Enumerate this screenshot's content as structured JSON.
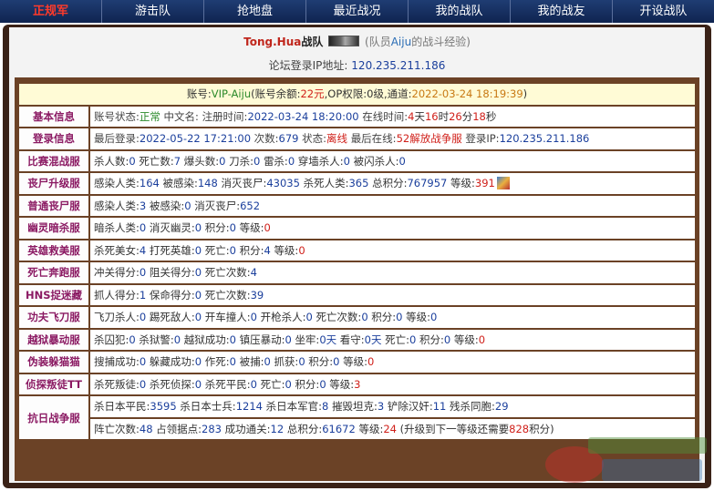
{
  "nav": {
    "items": [
      "正规军",
      "游击队",
      "抢地盘",
      "最近战况",
      "我的战队",
      "我的战友",
      "开设战队"
    ]
  },
  "header": {
    "team_name": "Tong.Hua",
    "team_suffix": "战队",
    "note_prefix": "(队员",
    "member": "Aiju",
    "note_suffix": "的战斗经验)",
    "ip_label": "论坛登录IP地址:",
    "ip_value": "120.235.211.186"
  },
  "account": {
    "label": "账号:",
    "name": "VIP-Aiju",
    "balance_label": "(账号余额:",
    "balance": "22元",
    "op_label": ",OP权限:",
    "op": "0级",
    "channel_label": ",通道:",
    "channel": "2022-03-24 18:19:39",
    "close": ")"
  },
  "rows": {
    "basic": {
      "label": "基本信息",
      "status_label": "账号状态:",
      "status": "正常",
      "cn_label": "中文名:",
      "reg_label": "注册时间:",
      "reg_time": "2022-03-24 18:20:00",
      "online_label": "在线时间:",
      "online_d": "4",
      "d": "天",
      "online_h": "16",
      "h": "时",
      "online_m": "26",
      "m": "分",
      "online_s": "18",
      "s": "秒"
    },
    "login": {
      "label": "登录信息",
      "last_label": "最后登录:",
      "last_time": "2022-05-22 17:21:00",
      "count_label": "次数:",
      "count": "679",
      "state_label": "状态:",
      "state": "离线",
      "last_online_label": "最后在线:",
      "last_online": "52解放战争服",
      "ip_label": "登录IP:",
      "ip": "120.235.211.186"
    },
    "mixed": {
      "label": "比赛混战服",
      "text_a": "杀人数:",
      "v1": "0",
      "text_b": "死亡数:",
      "v2": "7",
      "text_c": "爆头数:",
      "v3": "0",
      "text_d": "刀杀:",
      "v4": "0",
      "text_e": "雷杀:",
      "v5": "0",
      "text_f": "穿墙杀人:",
      "v6": "0",
      "text_g": "被闪杀人:",
      "v7": "0"
    },
    "zombie_up": {
      "label": "丧尸升级服",
      "t1": "感染人类:",
      "v1": "164",
      "t2": "被感染:",
      "v2": "148",
      "t3": "消灭丧尸:",
      "v3": "43035",
      "t4": "杀死人类:",
      "v4": "365",
      "t5": "总积分:",
      "v5": "767957",
      "t6": "等级:",
      "v6": "391"
    },
    "zombie": {
      "label": "普通丧尸服",
      "t1": "感染人类:",
      "v1": "3",
      "t2": "被感染:",
      "v2": "0",
      "t3": "消灭丧尸:",
      "v3": "652"
    },
    "ghost": {
      "label": "幽灵暗杀服",
      "t1": "暗杀人类:",
      "v1": "0",
      "t2": "消灭幽灵:",
      "v2": "0",
      "t3": "积分:",
      "v3": "0",
      "t4": "等级:",
      "v4": "0"
    },
    "hero": {
      "label": "英雄救美服",
      "t1": "杀死美女:",
      "v1": "4",
      "t2": "打死英雄:",
      "v2": "0",
      "t3": "死亡:",
      "v3": "0",
      "t4": "积分:",
      "v4": "4",
      "t5": "等级:",
      "v5": "0"
    },
    "deathrun": {
      "label": "死亡奔跑服",
      "t1": "冲关得分:",
      "v1": "0",
      "t2": "阻关得分:",
      "v2": "0",
      "t3": "死亡次数:",
      "v3": "4"
    },
    "hns": {
      "label": "HNS捉迷藏",
      "t1": "抓人得分:",
      "v1": "1",
      "t2": "保命得分:",
      "v2": "0",
      "t3": "死亡次数:",
      "v3": "39"
    },
    "knife": {
      "label": "功夫飞刀服",
      "t1": "飞刀杀人:",
      "v1": "0",
      "t2": "踢死敌人:",
      "v2": "0",
      "t3": "开车撞人:",
      "v3": "0",
      "t4": "开枪杀人:",
      "v4": "0",
      "t5": "死亡次数:",
      "v5": "0",
      "t6": "积分:",
      "v6": "0",
      "t7": "等级:",
      "v7": "0"
    },
    "jail": {
      "label": "越狱暴动服",
      "t1": "杀囚犯:",
      "v1": "0",
      "t2": "杀狱警:",
      "v2": "0",
      "t3": "越狱成功:",
      "v3": "0",
      "t4": "镇压暴动:",
      "v4": "0",
      "t5": "坐牢:",
      "v5": "0天",
      "t6": "看守:",
      "v6": "0天",
      "t7": "死亡:",
      "v7": "0",
      "t8": "积分:",
      "v8": "0",
      "t9": "等级:",
      "v9": "0"
    },
    "prop": {
      "label": "伪装躲猫猫",
      "t1": "搜捕成功:",
      "v1": "0",
      "t2": "躲藏成功:",
      "v2": "0",
      "t3": "作死:",
      "v3": "0",
      "t4": "被捕:",
      "v4": "0",
      "t5": "抓获:",
      "v5": "0",
      "t6": "积分:",
      "v6": "0",
      "t7": "等级:",
      "v7": "0"
    },
    "detective": {
      "label": "侦探叛徒TT",
      "t1": "杀死叛徒:",
      "v1": "0",
      "t2": "杀死侦探:",
      "v2": "0",
      "t3": "杀死平民:",
      "v3": "0",
      "t4": "死亡:",
      "v4": "0",
      "t5": "积分:",
      "v5": "0",
      "t6": "等级:",
      "v6": "3"
    },
    "war": {
      "label": "抗日战争服",
      "a1": "杀日本平民:",
      "av1": "3595",
      "a2": "杀日本士兵:",
      "av2": "1214",
      "a3": "杀日本军官:",
      "av3": "8",
      "a4": "摧毁坦克:",
      "av4": "3",
      "a5": "铲除汉奸:",
      "av5": "11",
      "a6": "残杀同胞:",
      "av6": "29",
      "b1": "阵亡次数:",
      "bv1": "48",
      "b2": "占领据点:",
      "bv2": "283",
      "b3": "成功通关:",
      "bv3": "12",
      "b4": "总积分:",
      "bv4": "61672",
      "b5": "等级:",
      "bv5": "24",
      "b6": "(升级到下一等级还需要",
      "bv6": "828",
      "b7": "积分)"
    }
  },
  "colors": {
    "nav_bg": "#1f3d73",
    "frame": "#3a2217",
    "table_border": "#6b4226",
    "label": "#8b1a63",
    "value": "#1b3f9c",
    "positive": "#2b8a2b",
    "alert": "#d0201a"
  }
}
